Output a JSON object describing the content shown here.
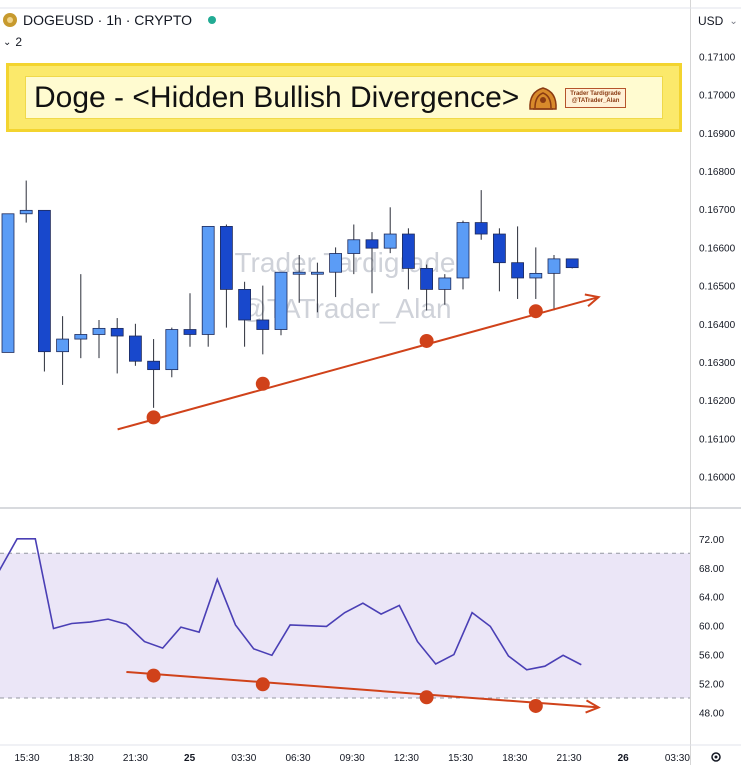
{
  "header": {
    "symbol": "DOGEUSD · 1h · CRYPTO",
    "collapse_count": "2",
    "currency": "USD",
    "icon_names": [
      "coin-icon",
      "status-dot",
      "chevron-down-icon",
      "settings-icon"
    ]
  },
  "banner": {
    "title": "Doge - <Hidden Bullish Divergence>",
    "tag_line1": "Trader Tardigrade",
    "tag_line2": "@TATrader_Alan"
  },
  "watermark": {
    "line1": "Trader Tardigrade",
    "line2": "@TATrader_Alan"
  },
  "colors": {
    "bull": "#5b9cf6",
    "bear": "#1848cc",
    "rsi_line": "#4a3fb5",
    "rsi_band": "#ebe6f7",
    "trendline": "#d0421a"
  },
  "chart_data": [
    {
      "type": "candlestick",
      "name": "DOGEUSD 1h",
      "y_axis_labels": [
        "0.17100",
        "0.17000",
        "0.16900",
        "0.16800",
        "0.16700",
        "0.16600",
        "0.16500",
        "0.16400",
        "0.16300",
        "0.16200",
        "0.16100",
        "0.16000"
      ],
      "ylim": [
        0.15957,
        0.17143
      ],
      "x_axis_labels": [
        "15:30",
        "18:30",
        "21:30",
        "25",
        "03:30",
        "06:30",
        "09:30",
        "12:30",
        "15:30",
        "18:30",
        "21:30",
        "26",
        "03:30"
      ],
      "candles": [
        {
          "o": 0.16325,
          "h": 0.16688,
          "l": 0.16325,
          "c": 0.16688
        },
        {
          "o": 0.16688,
          "h": 0.16775,
          "l": 0.16665,
          "c": 0.16697
        },
        {
          "o": 0.16697,
          "h": 0.16697,
          "l": 0.16275,
          "c": 0.16327
        },
        {
          "o": 0.16327,
          "h": 0.1642,
          "l": 0.1624,
          "c": 0.1636
        },
        {
          "o": 0.1636,
          "h": 0.1653,
          "l": 0.1631,
          "c": 0.16372
        },
        {
          "o": 0.16372,
          "h": 0.1641,
          "l": 0.1631,
          "c": 0.16388
        },
        {
          "o": 0.16388,
          "h": 0.16415,
          "l": 0.1627,
          "c": 0.16368
        },
        {
          "o": 0.16368,
          "h": 0.164,
          "l": 0.1629,
          "c": 0.16302
        },
        {
          "o": 0.16302,
          "h": 0.1636,
          "l": 0.1618,
          "c": 0.1628
        },
        {
          "o": 0.1628,
          "h": 0.1639,
          "l": 0.1626,
          "c": 0.16385
        },
        {
          "o": 0.16385,
          "h": 0.1648,
          "l": 0.1634,
          "c": 0.16372
        },
        {
          "o": 0.16372,
          "h": 0.16655,
          "l": 0.1634,
          "c": 0.16655
        },
        {
          "o": 0.16655,
          "h": 0.1666,
          "l": 0.1639,
          "c": 0.1649
        },
        {
          "o": 0.1649,
          "h": 0.1651,
          "l": 0.1634,
          "c": 0.1641
        },
        {
          "o": 0.1641,
          "h": 0.165,
          "l": 0.1632,
          "c": 0.16385
        },
        {
          "o": 0.16385,
          "h": 0.16535,
          "l": 0.1637,
          "c": 0.16535
        },
        {
          "o": 0.16535,
          "h": 0.1658,
          "l": 0.16455,
          "c": 0.16535
        },
        {
          "o": 0.16535,
          "h": 0.1656,
          "l": 0.1643,
          "c": 0.16535
        },
        {
          "o": 0.16535,
          "h": 0.166,
          "l": 0.1647,
          "c": 0.16584
        },
        {
          "o": 0.16584,
          "h": 0.1666,
          "l": 0.1653,
          "c": 0.1662
        },
        {
          "o": 0.1662,
          "h": 0.1664,
          "l": 0.1648,
          "c": 0.16598
        },
        {
          "o": 0.16598,
          "h": 0.16705,
          "l": 0.16585,
          "c": 0.16635
        },
        {
          "o": 0.16635,
          "h": 0.1665,
          "l": 0.1649,
          "c": 0.16545
        },
        {
          "o": 0.16545,
          "h": 0.16555,
          "l": 0.16435,
          "c": 0.1649
        },
        {
          "o": 0.1649,
          "h": 0.1653,
          "l": 0.1645,
          "c": 0.1652
        },
        {
          "o": 0.1652,
          "h": 0.1667,
          "l": 0.1649,
          "c": 0.16665
        },
        {
          "o": 0.16665,
          "h": 0.1675,
          "l": 0.1662,
          "c": 0.16635
        },
        {
          "o": 0.16635,
          "h": 0.1665,
          "l": 0.16485,
          "c": 0.1656
        },
        {
          "o": 0.1656,
          "h": 0.16655,
          "l": 0.16465,
          "c": 0.1652
        },
        {
          "o": 0.1652,
          "h": 0.166,
          "l": 0.16465,
          "c": 0.16532
        },
        {
          "o": 0.16532,
          "h": 0.1658,
          "l": 0.16435,
          "c": 0.1657
        },
        {
          "o": 0.1657,
          "h": 0.1657,
          "l": 0.16545,
          "c": 0.16547
        }
      ],
      "trendline": {
        "from": [
          8,
          0.16155
        ],
        "to": [
          33,
          0.1647
        ],
        "arrow": true
      },
      "pivot_points": [
        {
          "i": 8,
          "v": 0.16155
        },
        {
          "i": 14,
          "v": 0.16243
        },
        {
          "i": 23,
          "v": 0.16355
        },
        {
          "i": 29,
          "v": 0.16433
        }
      ]
    },
    {
      "type": "line",
      "name": "RSI",
      "y_axis_labels": [
        "72.00",
        "68.00",
        "64.00",
        "60.00",
        "56.00",
        "52.00",
        "48.00"
      ],
      "ylim": [
        44.2,
        74.6
      ],
      "band": [
        50,
        70
      ],
      "values": [
        67.5,
        72.0,
        72.0,
        59.6,
        60.3,
        60.5,
        60.9,
        60.2,
        57.8,
        56.9,
        59.8,
        59.1,
        66.4,
        60.1,
        56.8,
        55.9,
        60.1,
        60.0,
        59.9,
        61.8,
        63.1,
        61.6,
        62.8,
        57.8,
        54.7,
        56.0,
        61.8,
        59.9,
        55.8,
        53.9,
        54.4,
        55.9,
        54.6
      ],
      "trendline": {
        "from": [
          7,
          53.6
        ],
        "to": [
          33,
          48.7
        ],
        "arrow": true
      },
      "pivot_points": [
        {
          "i": 8,
          "v": 53.1
        },
        {
          "i": 14,
          "v": 51.9
        },
        {
          "i": 23,
          "v": 50.1
        },
        {
          "i": 29,
          "v": 48.9
        }
      ]
    }
  ]
}
